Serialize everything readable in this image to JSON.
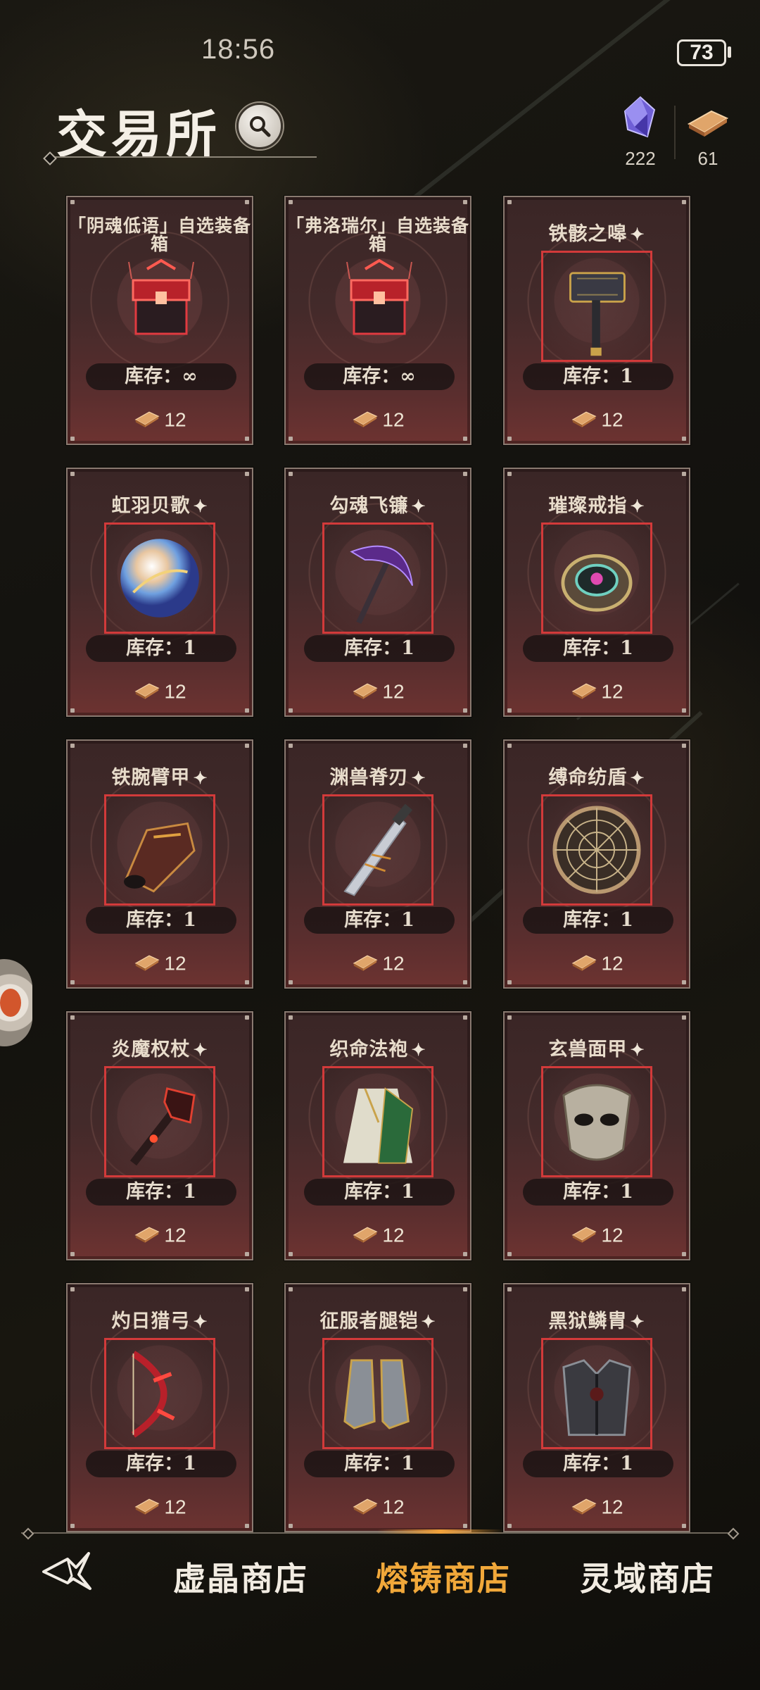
{
  "status_bar": {
    "time": "18:56",
    "battery": "73"
  },
  "header": {
    "title": "交易所"
  },
  "currencies": [
    {
      "icon": "crystal-icon",
      "value": "222"
    },
    {
      "icon": "ingot-icon",
      "value": "61"
    }
  ],
  "items": [
    {
      "name": "「阴魂低语」自选装备箱",
      "stock": "库存：∞",
      "price": "12",
      "icon": "chest-icon",
      "starred": false
    },
    {
      "name": "「弗洛瑞尔」自选装备箱",
      "stock": "库存：∞",
      "price": "12",
      "icon": "chest-icon",
      "starred": false
    },
    {
      "name": "铁骸之嗥",
      "stock": "库存：1",
      "price": "12",
      "icon": "hammer-icon",
      "starred": true
    },
    {
      "name": "虹羽贝歌",
      "stock": "库存：1",
      "price": "12",
      "icon": "orb-icon",
      "starred": true
    },
    {
      "name": "勾魂飞镰",
      "stock": "库存：1",
      "price": "12",
      "icon": "scythe-icon",
      "starred": true
    },
    {
      "name": "璀璨戒指",
      "stock": "库存：1",
      "price": "12",
      "icon": "ring-icon",
      "starred": true
    },
    {
      "name": "铁腕臂甲",
      "stock": "库存：1",
      "price": "12",
      "icon": "bracer-icon",
      "starred": true
    },
    {
      "name": "渊兽脊刃",
      "stock": "库存：1",
      "price": "12",
      "icon": "blade-icon",
      "starred": true
    },
    {
      "name": "缚命纺盾",
      "stock": "库存：1",
      "price": "12",
      "icon": "shield-icon",
      "starred": true
    },
    {
      "name": "炎魔权杖",
      "stock": "库存：1",
      "price": "12",
      "icon": "scepter-icon",
      "starred": true
    },
    {
      "name": "织命法袍",
      "stock": "库存：1",
      "price": "12",
      "icon": "robe-icon",
      "starred": true
    },
    {
      "name": "玄兽面甲",
      "stock": "库存：1",
      "price": "12",
      "icon": "mask-icon",
      "starred": true
    },
    {
      "name": "灼日猎弓",
      "stock": "库存：1",
      "price": "12",
      "icon": "bow-icon",
      "starred": true
    },
    {
      "name": "征服者腿铠",
      "stock": "库存：1",
      "price": "12",
      "icon": "greaves-icon",
      "starred": true
    },
    {
      "name": "黑狱鳞胄",
      "stock": "库存：1",
      "price": "12",
      "icon": "armor-icon",
      "starred": true
    }
  ],
  "star_glyph": "✦",
  "nav": {
    "tabs": [
      {
        "label": "虚晶商店",
        "active": false
      },
      {
        "label": "熔铸商店",
        "active": true
      },
      {
        "label": "灵域商店",
        "active": false
      }
    ],
    "accent_color": "#f1a83a"
  }
}
